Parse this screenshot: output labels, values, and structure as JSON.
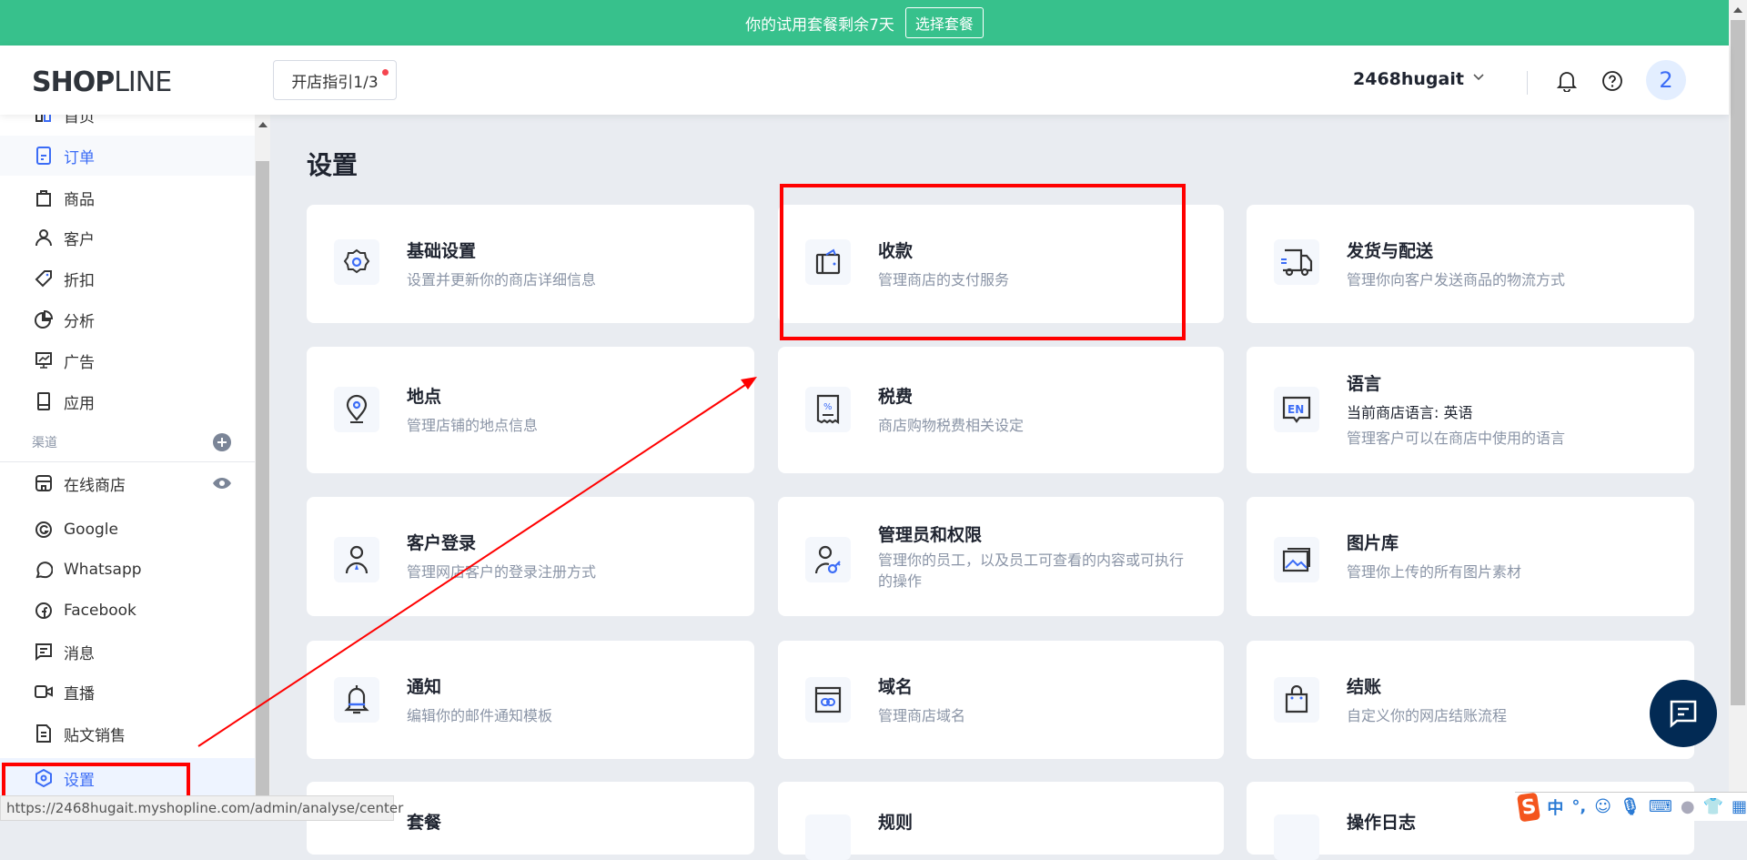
{
  "banner": {
    "text": "你的试用套餐剩余7天",
    "button": "选择套餐",
    "color": "#37c18c"
  },
  "header": {
    "logo": "SHOPLINE",
    "guide": "开店指引1/3",
    "username": "2468hugait",
    "avatar": "2"
  },
  "sidebar": {
    "items": [
      {
        "label": "首页",
        "icon": "home-icon"
      },
      {
        "label": "订单",
        "icon": "order-icon"
      },
      {
        "label": "商品",
        "icon": "bag-icon"
      },
      {
        "label": "客户",
        "icon": "user-icon"
      },
      {
        "label": "折扣",
        "icon": "tag-icon"
      },
      {
        "label": "分析",
        "icon": "pie-chart-icon"
      },
      {
        "label": "广告",
        "icon": "monitor-icon"
      },
      {
        "label": "应用",
        "icon": "app-icon"
      }
    ],
    "group_label": "渠道",
    "channels": [
      {
        "label": "在线商店",
        "icon": "store-icon"
      },
      {
        "label": "Google",
        "icon": "google-icon"
      },
      {
        "label": "Whatsapp",
        "icon": "whatsapp-icon"
      },
      {
        "label": "Facebook",
        "icon": "facebook-icon"
      },
      {
        "label": "消息",
        "icon": "message-icon"
      },
      {
        "label": "直播",
        "icon": "video-icon"
      },
      {
        "label": "贴文销售",
        "icon": "post-icon"
      }
    ],
    "settings": "设置"
  },
  "page": {
    "title": "设置"
  },
  "cards": [
    {
      "title": "基础设置",
      "desc": "设置并更新你的商店详细信息"
    },
    {
      "title": "收款",
      "desc": "管理商店的支付服务"
    },
    {
      "title": "发货与配送",
      "desc": "管理你向客户发送商品的物流方式"
    },
    {
      "title": "地点",
      "desc": "管理店铺的地点信息"
    },
    {
      "title": "税费",
      "desc": "商店购物税费相关设定"
    },
    {
      "title": "语言",
      "sub": "当前商店语言: 英语",
      "desc": "管理客户可以在商店中使用的语言"
    },
    {
      "title": "客户登录",
      "desc": "管理网店客户的登录注册方式"
    },
    {
      "title": "管理员和权限",
      "desc": "管理你的员工，以及员工可查看的内容或可执行的操作"
    },
    {
      "title": "图片库",
      "desc": "管理你上传的所有图片素材"
    },
    {
      "title": "通知",
      "desc": "编辑你的邮件通知模板"
    },
    {
      "title": "域名",
      "desc": "管理商店域名"
    },
    {
      "title": "结账",
      "desc": "自定义你的网店结账流程"
    },
    {
      "title": "套餐"
    },
    {
      "title": "规则"
    },
    {
      "title": "操作日志"
    }
  ],
  "status_url": "https://2468hugait.myshopline.com/admin/analyse/center",
  "ime": {
    "mode": "中",
    "punct": "°,"
  }
}
